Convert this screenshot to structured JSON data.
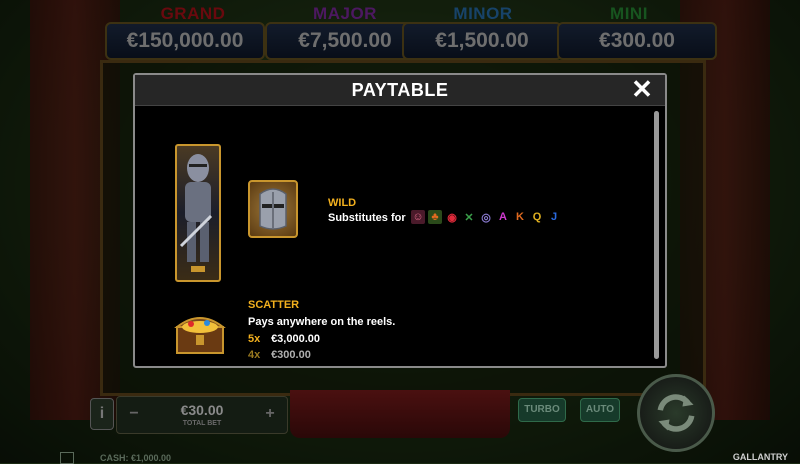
{
  "jackpots": [
    {
      "label": "GRAND",
      "value": "€150,000.00",
      "color": "#c0121b"
    },
    {
      "label": "MAJOR",
      "value": "€7,500.00",
      "color": "#8a2db0"
    },
    {
      "label": "MINOR",
      "value": "€1,500.00",
      "color": "#2a7ac0"
    },
    {
      "label": "MINI",
      "value": "€300.00",
      "color": "#2a9a3a"
    }
  ],
  "modal": {
    "title": "PAYTABLE",
    "close_icon": "close-icon"
  },
  "wild": {
    "title": "WILD",
    "text": "Substitutes for",
    "symbols": [
      {
        "icon": "princess-icon",
        "glyph": "☺",
        "color": "#e06a8a"
      },
      {
        "icon": "dragon-icon",
        "glyph": "♣",
        "color": "#c04a20"
      },
      {
        "icon": "lips-icon",
        "glyph": "◉",
        "color": "#c01a2a"
      },
      {
        "icon": "sword-icon",
        "glyph": "✕",
        "color": "#3aa04a"
      },
      {
        "icon": "ring-icon",
        "glyph": "◎",
        "color": "#8a7ad0"
      },
      {
        "icon": "letter-a",
        "glyph": "A",
        "color": "#d03ad0"
      },
      {
        "icon": "letter-k",
        "glyph": "K",
        "color": "#e06a20"
      },
      {
        "icon": "letter-q",
        "glyph": "Q",
        "color": "#e0b020"
      },
      {
        "icon": "letter-j",
        "glyph": "J",
        "color": "#2a6ae0"
      }
    ]
  },
  "scatter": {
    "title": "SCATTER",
    "text": "Pays anywhere on the reels.",
    "pays": [
      {
        "mult": "5x",
        "value": "€3,000.00"
      },
      {
        "mult": "4x",
        "value": "€300.00"
      }
    ]
  },
  "bottom": {
    "info_label": "i",
    "bet_value": "€30.00",
    "bet_label": "TOTAL BET",
    "minus": "−",
    "plus": "+",
    "turbo_label": "TURBO",
    "auto_label": "AUTO",
    "cash_label": "CASH: €1,000.00",
    "game_name": "GALLANTRY"
  }
}
